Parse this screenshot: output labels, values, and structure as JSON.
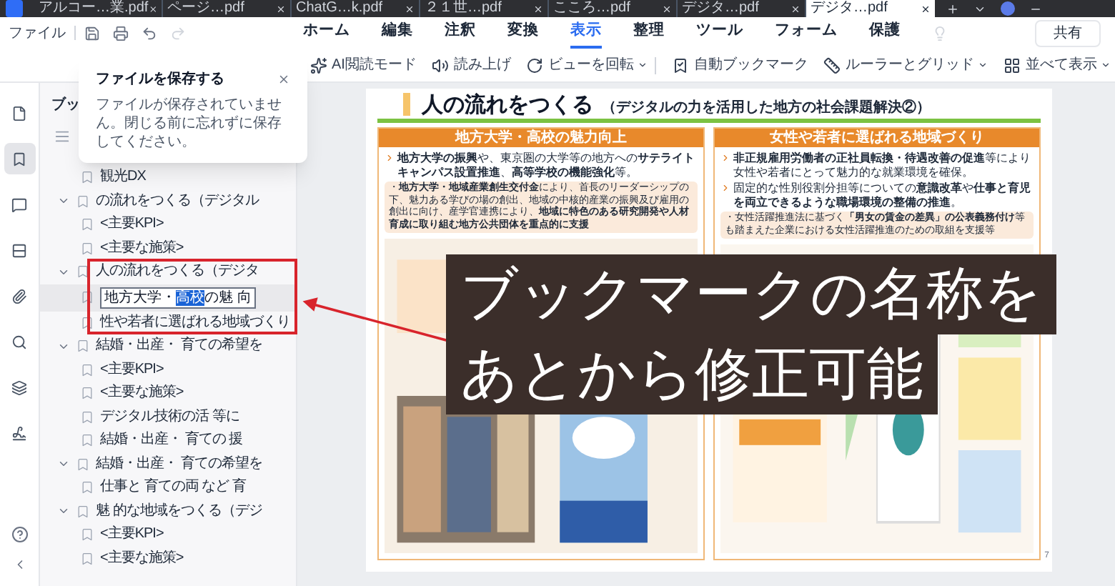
{
  "browser_tabs": [
    {
      "label": "アルコー…業.pdf",
      "selected": false
    },
    {
      "label": "ページ…pdf",
      "selected": false
    },
    {
      "label": "ChatG…k.pdf",
      "selected": false
    },
    {
      "label": "２１世…pdf",
      "selected": false
    },
    {
      "label": "こころ…pdf",
      "selected": false
    },
    {
      "label": "デジタ…pdf",
      "selected": false
    },
    {
      "label": "デジタ…pdf",
      "selected": true
    }
  ],
  "menu": {
    "file": "ファイル",
    "tabs": [
      {
        "label": "ホーム",
        "selected": false
      },
      {
        "label": "編集",
        "selected": false
      },
      {
        "label": "注釈",
        "selected": false
      },
      {
        "label": "変換",
        "selected": false
      },
      {
        "label": "表示",
        "selected": true
      },
      {
        "label": "整理",
        "selected": false
      },
      {
        "label": "ツール",
        "selected": false
      },
      {
        "label": "フォーム",
        "selected": false
      },
      {
        "label": "保護",
        "selected": false
      }
    ],
    "share": "共有"
  },
  "toolbar": [
    {
      "label": "AI閲読モード",
      "dropdown": false
    },
    {
      "label": "読み上げ",
      "dropdown": false
    },
    {
      "label": "ビューを回転",
      "dropdown": true
    },
    {
      "label": "自動ブックマーク",
      "dropdown": false
    },
    {
      "label": "ルーラーとグリッド",
      "dropdown": true
    },
    {
      "label": "並べて表示",
      "dropdown": true
    }
  ],
  "popup": {
    "title": "ファイルを保存する",
    "message": "ファイルが保存されていません。閉じる前に忘れずに保存してください。"
  },
  "rail": [
    {
      "selected": false
    },
    {
      "selected": true
    },
    {
      "selected": false
    },
    {
      "selected": false
    },
    {
      "selected": false
    },
    {
      "selected": false
    },
    {
      "selected": false
    },
    {
      "selected": false
    }
  ],
  "bookmarks": {
    "title": "ブッ",
    "items": [
      {
        "children": [
          {
            "label": "観光DX"
          }
        ]
      },
      {
        "label": "の流れをつくる（デジタル",
        "expanded": true,
        "children": [
          {
            "label": "<主要KPI>"
          },
          {
            "label": "<主要な施策>"
          }
        ]
      },
      {
        "label": "人の流れをつくる（デジタ",
        "expanded": true,
        "children": [
          {
            "kind": "editing",
            "value_before": "地方大学・",
            "value_selected": "高校",
            "value_after": "の魅 向"
          },
          {
            "label": "性や若者に選ばれる地域づくり"
          }
        ]
      },
      {
        "label": "結婚・出産・ 育ての希望を",
        "expanded": true,
        "children": [
          {
            "label": "<主要KPI>"
          },
          {
            "label": "<主要な施策>"
          },
          {
            "label": "デジタル技術の活 等に"
          },
          {
            "label": "結婚・出産・ 育ての 援"
          }
        ]
      },
      {
        "label": "結婚・出産・ 育ての希望を",
        "expanded": true,
        "children": [
          {
            "label": "仕事と 育ての両 など 育"
          }
        ]
      },
      {
        "label": "魅 的な地域をつくる（デジ",
        "expanded": true,
        "children": [
          {
            "label": "<主要KPI>"
          },
          {
            "label": "<主要な施策>"
          }
        ]
      }
    ]
  },
  "document": {
    "title": "人の流れをつくる",
    "subtitle": "（デジタルの力を活用した地方の社会課題解決②）",
    "page_number": "7",
    "columns": [
      {
        "heading": "地方大学・高校の魅力向上",
        "blocks": [
          {
            "kind": "bullet",
            "text": "**地方大学の振興**や、東京圏の大学等の地方への**サテライトキャンパス設置推進**、**高等学校の機能強化**等。"
          },
          {
            "kind": "note",
            "text": "・**地方大学・地域産業創生交付金**により、首長のリーダーシップの下、魅力ある学びの場の創出、地域の中核的産業の振興及び雇用の創出に向け、産学官連携により、**地域に特色のある研究開発や人材育成に取り組む地方公共団体を重点的に支援**"
          }
        ]
      },
      {
        "heading": "女性や若者に選ばれる地域づくり",
        "blocks": [
          {
            "kind": "bullet",
            "text": "**非正規雇用労働者の正社員転換・待遇改善の促進**等により女性や若者にとって魅力的な就業環境を確保。"
          },
          {
            "kind": "bullet",
            "text": "固定的な性別役割分担等についての**意識改革**や**仕事と育児を両立できるような職場環境の整備の推進**。"
          },
          {
            "kind": "note",
            "text": "・女性活躍推進法に基づく**「男女の賃金の差異」の公表義務付け**等も踏まえた企業における女性活躍推進のための取組を支援等"
          }
        ]
      }
    ]
  },
  "caption": {
    "lines": [
      "ブックマークの名称を",
      "あとから修正可能"
    ]
  }
}
